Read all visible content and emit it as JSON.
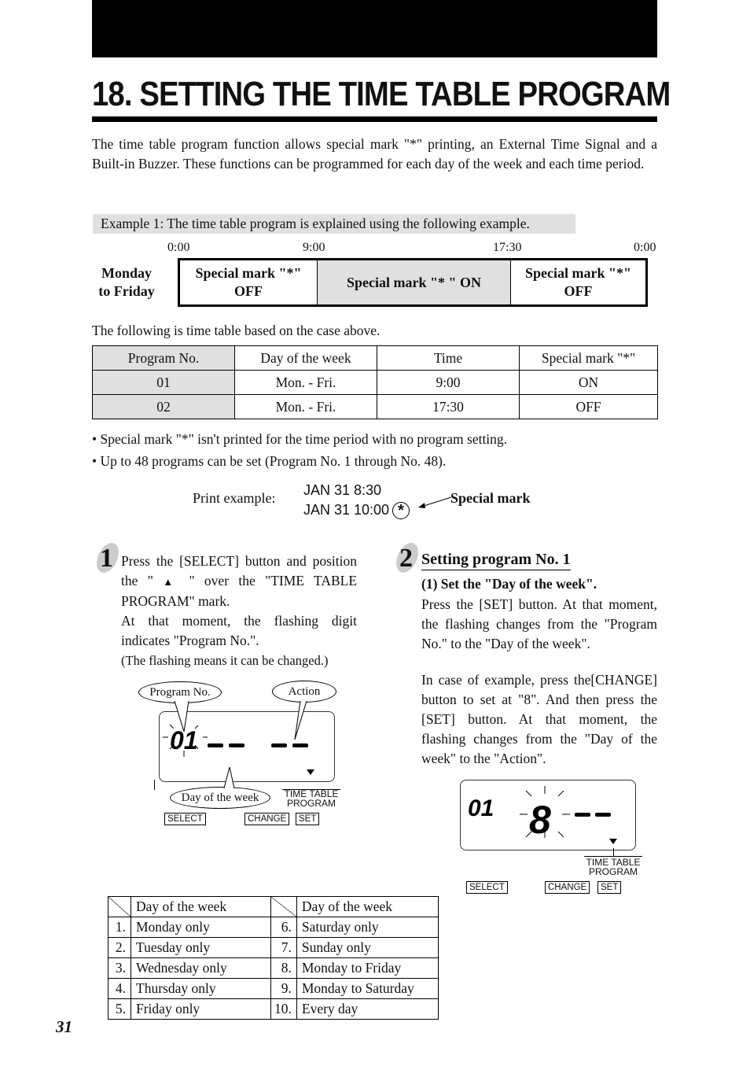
{
  "page": {
    "title": "18. SETTING THE TIME TABLE PROGRAM",
    "intro": "The time table program function allows special mark \"*\" printing, an External Time Signal and a Built-in Buzzer. These functions can be programmed for each day of the week and each time period.",
    "example_banner": "Example 1: The time table program is explained using the following example.",
    "page_number": "31"
  },
  "timeline": {
    "row_label_line1": "Monday",
    "row_label_line2": "to Friday",
    "ticks": [
      "0:00",
      "9:00",
      "17:30",
      "0:00"
    ],
    "segments": [
      {
        "line1": "Special mark \"*\"",
        "line2": "OFF"
      },
      {
        "line1": "Special mark \"* \" ON",
        "line2": ""
      },
      {
        "line1": "Special mark \"*\"",
        "line2": "OFF"
      }
    ]
  },
  "program_table": {
    "caption": "The following is time table based on the case above.",
    "headers": [
      "Program No.",
      "Day of the week",
      "Time",
      "Special mark \"*\""
    ],
    "rows": [
      [
        "01",
        "Mon. - Fri.",
        "9:00",
        "ON"
      ],
      [
        "02",
        "Mon. - Fri.",
        "17:30",
        "OFF"
      ]
    ]
  },
  "notes": [
    "• Special mark \"*\" isn't printed for the time period with no program setting.",
    "• Up to 48 programs can be set (Program No. 1 through No. 48)."
  ],
  "print_example": {
    "label": "Print example:",
    "line1": "JAN 31 8:30",
    "line2": "JAN 31 10:00",
    "mark_symbol": "*",
    "mark_label": "Special mark"
  },
  "step1": {
    "number": "1",
    "text_a_pre": "Press the [SELECT] button and position the \"",
    "text_a_symbol": "▲",
    "text_a_post": "\" over the \"TIME TABLE PROGRAM\" mark.",
    "text_b": "At that moment, the flashing digit indicates \"Program No.\".",
    "text_c": "(The flashing means it can be changed.)",
    "lcd": {
      "digits": "01",
      "callout_program": "Program No.",
      "callout_action": "Action",
      "callout_day": "Day of the week",
      "indicator_line1": "TIME TABLE",
      "indicator_line2": "PROGRAM",
      "buttons": [
        "SELECT",
        "CHANGE",
        "SET"
      ]
    }
  },
  "step2": {
    "number": "2",
    "heading": "Setting program No. 1",
    "subheading": "(1) Set the \"Day of the week\".",
    "para1": "Press the [SET] button. At that moment, the flashing changes from the \"Program No.\" to the \"Day of the week\".",
    "para2": "In case of example, press the[CHANGE] button to set at \"8\". And then press the [SET] button. At that moment, the flashing changes from the \"Day of the week\" to the \"Action\".",
    "lcd": {
      "digits": "01",
      "day_digit": "8",
      "indicator_line1": "TIME TABLE",
      "indicator_line2": "PROGRAM",
      "buttons": [
        "SELECT",
        "CHANGE",
        "SET"
      ]
    }
  },
  "days_table": {
    "header": "Day of the week",
    "left": [
      {
        "num": "1.",
        "label": "Monday only"
      },
      {
        "num": "2.",
        "label": "Tuesday only"
      },
      {
        "num": "3.",
        "label": "Wednesday only"
      },
      {
        "num": "4.",
        "label": "Thursday only"
      },
      {
        "num": "5.",
        "label": "Friday only"
      }
    ],
    "right": [
      {
        "num": "6.",
        "label": "Saturday only"
      },
      {
        "num": "7.",
        "label": "Sunday only"
      },
      {
        "num": "8.",
        "label": "Monday to Friday"
      },
      {
        "num": "9.",
        "label": "Monday to Saturday"
      },
      {
        "num": "10.",
        "label": "Every day"
      }
    ]
  }
}
